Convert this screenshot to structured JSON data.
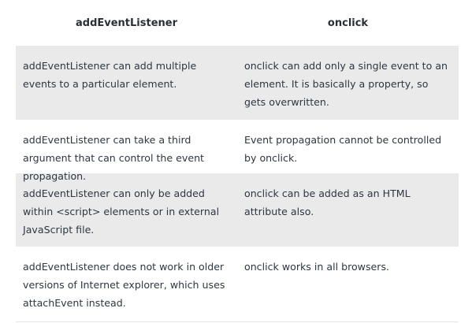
{
  "table": {
    "headers": [
      "addEventListener",
      "onclick"
    ],
    "rows": [
      {
        "left": "addEventListener can add multiple events to a particular element.",
        "right": "onclick can add only a single event to an element. It is basically a property, so gets overwritten."
      },
      {
        "left": "addEventListener can take a third argument that can control the event propagation.",
        "right": "Event propagation cannot be controlled by onclick."
      },
      {
        "left": "addEventListener can only be added within <script> elements or in external JavaScript file.",
        "right": "onclick can be added as an HTML attribute also."
      },
      {
        "left": "addEventListener does not work in older versions of Internet explorer, which uses attachEvent instead.",
        "right": "onclick works in all browsers."
      }
    ]
  }
}
